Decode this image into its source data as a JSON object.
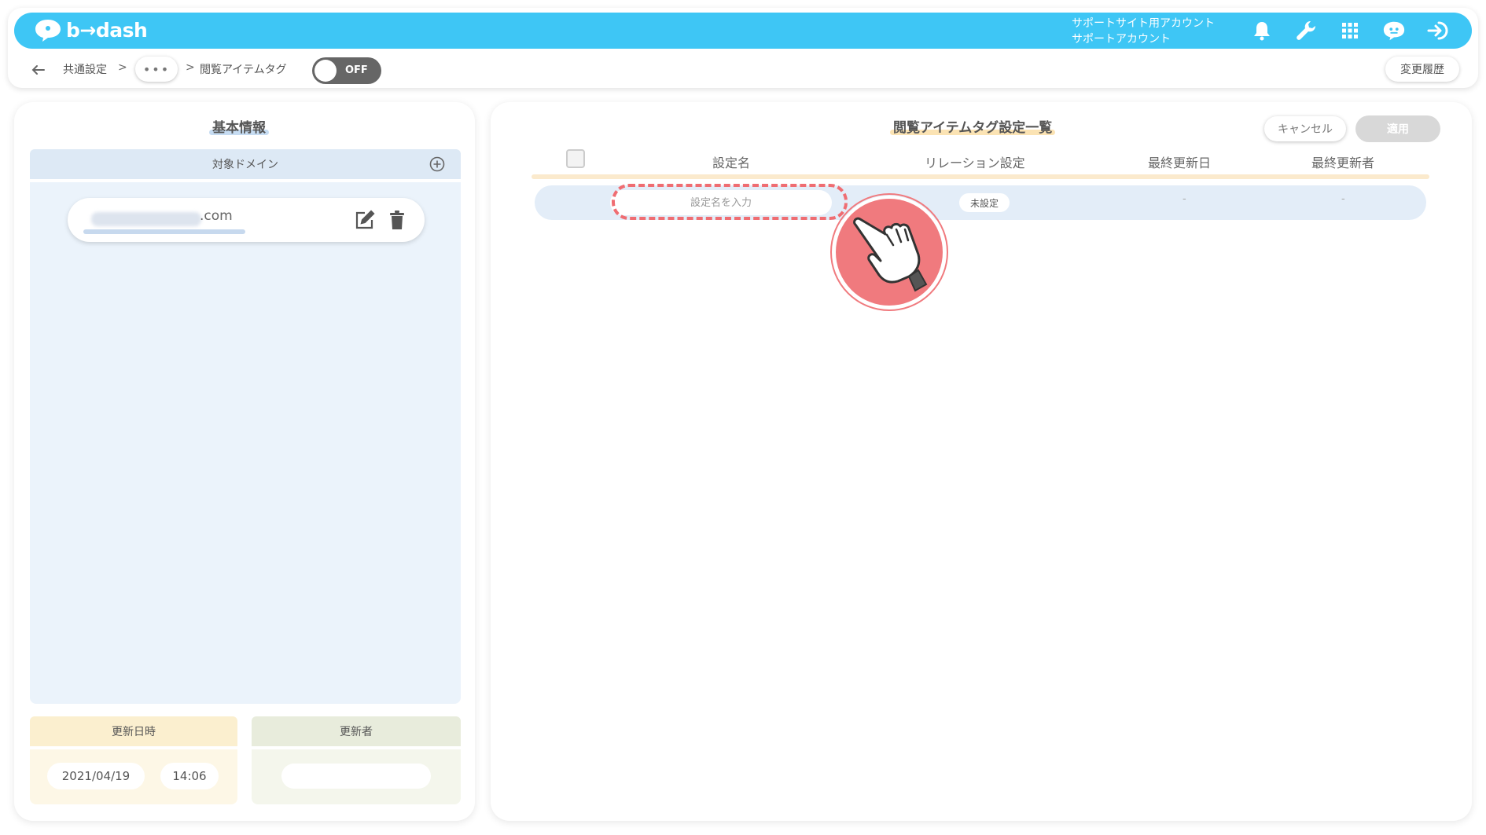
{
  "header": {
    "logo_text": "b→dash",
    "account_line1": "サポートサイト用アカウント",
    "account_line2": "サポートアカウント",
    "brand_color": "#3ec6f5",
    "icons": [
      "bell-icon",
      "wrench-icon",
      "apps-grid-icon",
      "chatbot-icon",
      "logout-icon"
    ]
  },
  "subbar": {
    "crumb1": "共通設定",
    "sep": ">",
    "more": "•••",
    "crumb2": "閲覧アイテムタグ",
    "toggle_label": "OFF",
    "history_label": "変更履歴"
  },
  "basic_info": {
    "title": "基本情報",
    "domain_header": "対象ドメイン",
    "domain_suffix": ".com",
    "updated_header": "更新日時",
    "updated_date": "2021/04/19",
    "updated_time": "14:06",
    "updater_header": "更新者"
  },
  "tag_list": {
    "title": "閲覧アイテムタグ設定一覧",
    "cancel_label": "キャンセル",
    "apply_label": "適用",
    "columns": [
      "設定名",
      "リレーション設定",
      "最終更新日",
      "最終更新者"
    ],
    "row": {
      "name_placeholder": "設定名を入力",
      "relation": "未設定",
      "last_updated": "-",
      "last_updater": "-"
    },
    "highlight_color": "#ef6d72"
  }
}
